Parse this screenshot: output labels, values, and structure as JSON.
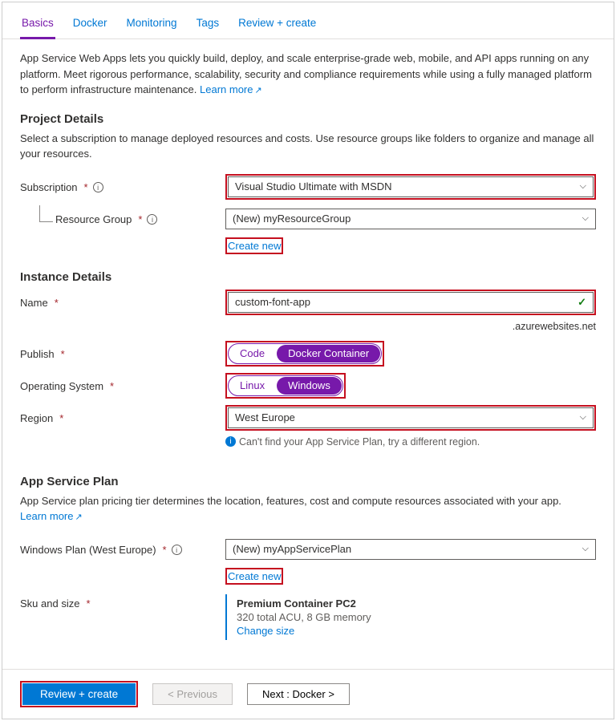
{
  "tabs": {
    "basics": "Basics",
    "docker": "Docker",
    "monitoring": "Monitoring",
    "tags": "Tags",
    "review": "Review + create"
  },
  "intro": {
    "text": "App Service Web Apps lets you quickly build, deploy, and scale enterprise-grade web, mobile, and API apps running on any platform. Meet rigorous performance, scalability, security and compliance requirements while using a fully managed platform to perform infrastructure maintenance.  ",
    "learn_more": "Learn more"
  },
  "project": {
    "heading": "Project Details",
    "desc": "Select a subscription to manage deployed resources and costs. Use resource groups like folders to organize and manage all your resources.",
    "subscription_label": "Subscription",
    "subscription_value": "Visual Studio Ultimate with MSDN",
    "rg_label": "Resource Group",
    "rg_value": "(New) myResourceGroup",
    "create_new": "Create new"
  },
  "instance": {
    "heading": "Instance Details",
    "name_label": "Name",
    "name_value": "custom-font-app",
    "suffix": ".azurewebsites.net",
    "publish_label": "Publish",
    "publish_code": "Code",
    "publish_docker": "Docker Container",
    "os_label": "Operating System",
    "os_linux": "Linux",
    "os_windows": "Windows",
    "region_label": "Region",
    "region_value": "West Europe",
    "region_help": "Can't find your App Service Plan, try a different region."
  },
  "plan": {
    "heading": "App Service Plan",
    "desc": "App Service plan pricing tier determines the location, features, cost and compute resources associated with your app.",
    "learn_more": "Learn more",
    "plan_label": "Windows Plan (West Europe)",
    "plan_value": "(New) myAppServicePlan",
    "create_new": "Create new",
    "sku_label": "Sku and size",
    "sku_title": "Premium Container PC2",
    "sku_detail": "320 total ACU, 8 GB memory",
    "change_size": "Change size"
  },
  "footer": {
    "review": "Review + create",
    "previous": "< Previous",
    "next": "Next : Docker >"
  }
}
